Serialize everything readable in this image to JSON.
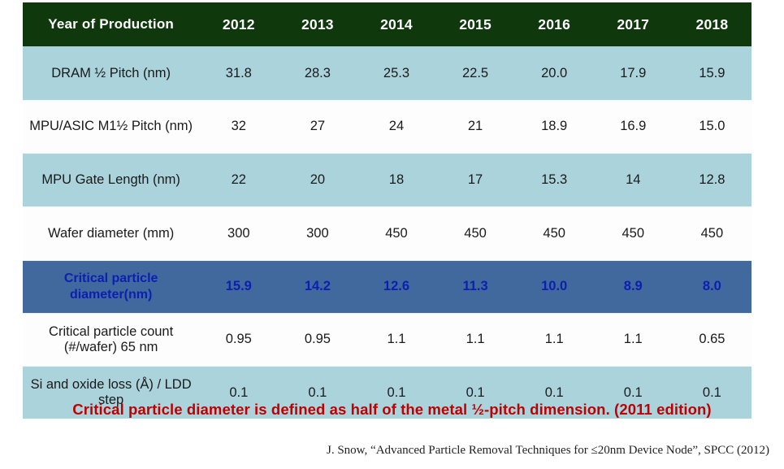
{
  "table": {
    "columns": [
      "Year of Production",
      "2012",
      "2013",
      "2014",
      "2015",
      "2016",
      "2017",
      "2018"
    ],
    "rows": [
      {
        "label": "DRAM ½ Pitch (nm)",
        "values": [
          "31.8",
          "28.3",
          "25.3",
          "22.5",
          "20.0",
          "17.9",
          "15.9"
        ],
        "style": "teal",
        "highlight": false
      },
      {
        "label": "MPU/ASIC M1½ Pitch (nm)",
        "values": [
          "32",
          "27",
          "24",
          "21",
          "18.9",
          "16.9",
          "15.0"
        ],
        "style": "white",
        "highlight": false
      },
      {
        "label": "MPU Gate Length (nm)",
        "values": [
          "22",
          "20",
          "18",
          "17",
          "15.3",
          "14",
          "12.8"
        ],
        "style": "teal",
        "highlight": false
      },
      {
        "label": "Wafer diameter (mm)",
        "values": [
          "300",
          "300",
          "450",
          "450",
          "450",
          "450",
          "450"
        ],
        "style": "white",
        "highlight": false
      },
      {
        "label": "Critical particle diameter(nm)",
        "values": [
          "15.9",
          "14.2",
          "12.6",
          "11.3",
          "10.0",
          "8.9",
          "8.0"
        ],
        "style": "accent",
        "highlight": true
      },
      {
        "label": "Critical particle count (#/wafer) 65 nm",
        "values": [
          "0.95",
          "0.95",
          "1.1",
          "1.1",
          "1.1",
          "1.1",
          "0.65"
        ],
        "style": "white",
        "highlight": false
      },
      {
        "label": "Si and oxide loss (Å) / LDD step",
        "values": [
          "0.1",
          "0.1",
          "0.1",
          "0.1",
          "0.1",
          "0.1",
          "0.1"
        ],
        "style": "teal",
        "highlight": false
      }
    ]
  },
  "caption": "Critical particle diameter is defined as half of the metal ½-pitch dimension. (2011 edition)",
  "citation": "J. Snow, “Advanced Particle Removal Techniques for ≤20nm Device Node”, SPCC (2012)",
  "colors": {
    "header_background": "#10380D",
    "header_text": "#FFFFFF",
    "row_teal": "#ABD3DB",
    "row_white": "#FDFDFD",
    "row_accent_background": "#41699E",
    "row_accent_text": "#0C1FB0",
    "caption_text": "#C00000",
    "body_text": "#1A1A1A"
  }
}
